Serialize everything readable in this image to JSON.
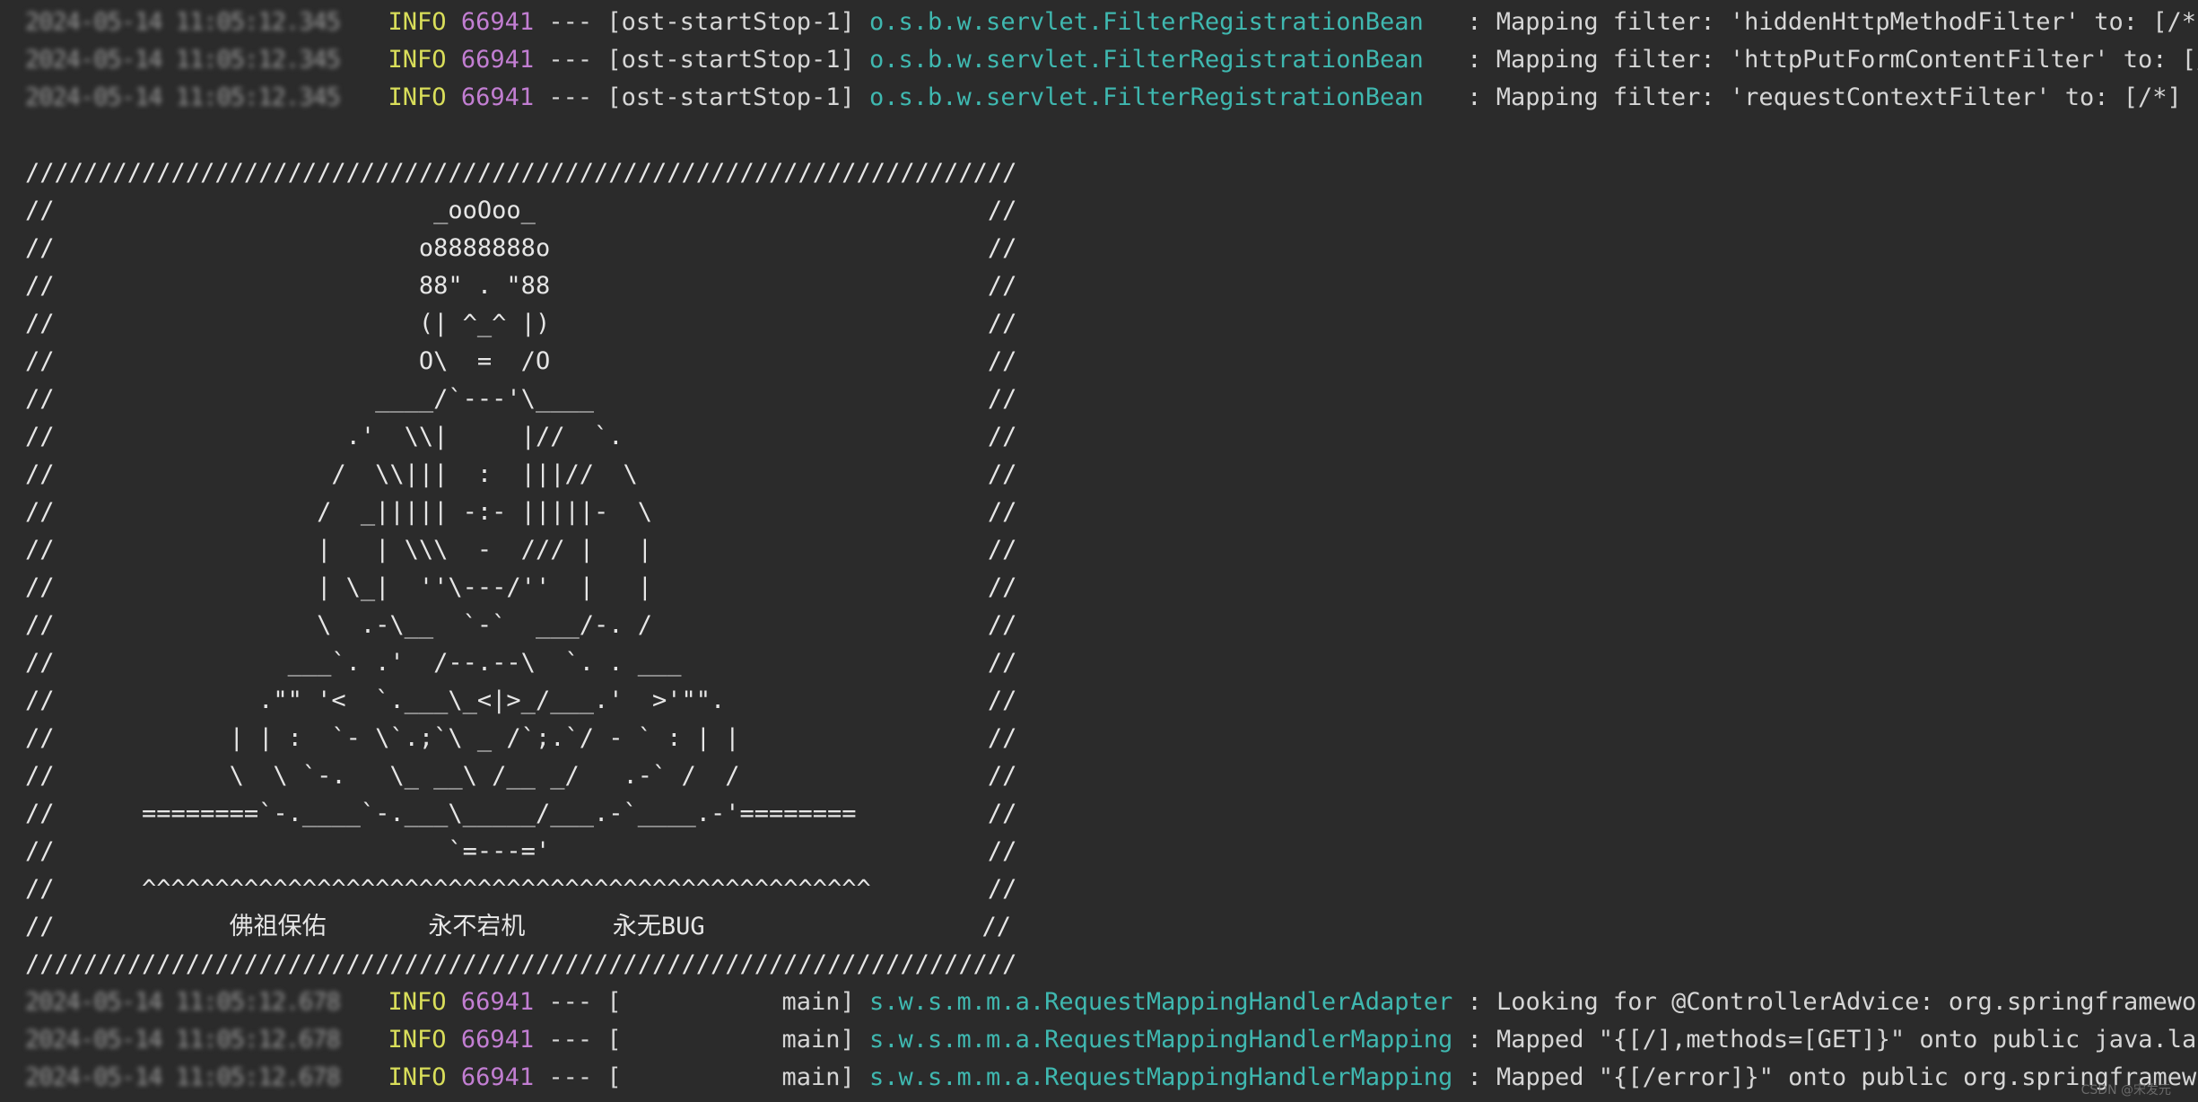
{
  "colors": {
    "background": "#2b2b2b",
    "level_info": "#d9de5a",
    "pid": "#c27ed2",
    "logger": "#3fb8b0",
    "text": "#d6d6d6"
  },
  "top_logs": [
    {
      "timestamp": "2024-05-14 11:05:12.345",
      "level": "INFO",
      "pid": "66941",
      "sep": "---",
      "thread": "[ost-startStop-1]",
      "logger": "o.s.b.w.servlet.FilterRegistrationBean",
      "message": ": Mapping filter: 'hiddenHttpMethodFilter' to: [/*]"
    },
    {
      "timestamp": "2024-05-14 11:05:12.345",
      "level": "INFO",
      "pid": "66941",
      "sep": "---",
      "thread": "[ost-startStop-1]",
      "logger": "o.s.b.w.servlet.FilterRegistrationBean",
      "message": ": Mapping filter: 'httpPutFormContentFilter' to: [/*]"
    },
    {
      "timestamp": "2024-05-14 11:05:12.345",
      "level": "INFO",
      "pid": "66941",
      "sep": "---",
      "thread": "[ost-startStop-1]",
      "logger": "o.s.b.w.servlet.FilterRegistrationBean",
      "message": ": Mapping filter: 'requestContextFilter' to: [/*]"
    }
  ],
  "banner": [
    "////////////////////////////////////////////////////////////////////",
    "//                          _ooOoo_                               //",
    "//                         o8888888o                              //",
    "//                         88\" . \"88                              //",
    "//                         (| ^_^ |)                              //",
    "//                         O\\  =  /O                              //",
    "//                      ____/`---'\\____                           //",
    "//                    .'  \\\\|     |//  `.                         //",
    "//                   /  \\\\|||  :  |||//  \\                        //",
    "//                  /  _||||| -:- |||||-  \\                       //",
    "//                  |   | \\\\\\  -  /// |   |                       //",
    "//                  | \\_|  ''\\---/''  |   |                       //",
    "//                  \\  .-\\__  `-`  ___/-. /                       //",
    "//                ___`. .'  /--.--\\  `. . ___                     //",
    "//              .\"\" '<  `.___\\_<|>_/___.'  >'\"\".                  //",
    "//            | | :  `- \\`.;`\\ _ /`;.`/ - ` : | |                 //",
    "//            \\  \\ `-.   \\_ __\\ /__ _/   .-` /  /                 //",
    "//      ========`-.____`-.___\\_____/___.-`____.-'========         //",
    "//                           `=---='                              //",
    "//      ^^^^^^^^^^^^^^^^^^^^^^^^^^^^^^^^^^^^^^^^^^^^^^^^^^        //",
    "//            佛祖保佑       永不宕机      永无BUG                   //",
    "////////////////////////////////////////////////////////////////////"
  ],
  "bottom_logs": [
    {
      "timestamp": "2024-05-14 11:05:12.678",
      "level": "INFO",
      "pid": "66941",
      "sep": "---",
      "thread": "[           main]",
      "logger": "s.w.s.m.m.a.RequestMappingHandlerAdapter",
      "message": ": Looking for @ControllerAdvice: org.springframework."
    },
    {
      "timestamp": "2024-05-14 11:05:12.678",
      "level": "INFO",
      "pid": "66941",
      "sep": "---",
      "thread": "[           main]",
      "logger": "s.w.s.m.m.a.RequestMappingHandlerMapping",
      "message": ": Mapped \"{[/],methods=[GET]}\" onto public java.lang."
    },
    {
      "timestamp": "2024-05-14 11:05:12.678",
      "level": "INFO",
      "pid": "66941",
      "sep": "---",
      "thread": "[           main]",
      "logger": "s.w.s.m.m.a.RequestMappingHandlerMapping",
      "message": ": Mapped \"{[/error]}\" onto public org.springframework"
    }
  ],
  "watermark": "CSDN @宋发元"
}
